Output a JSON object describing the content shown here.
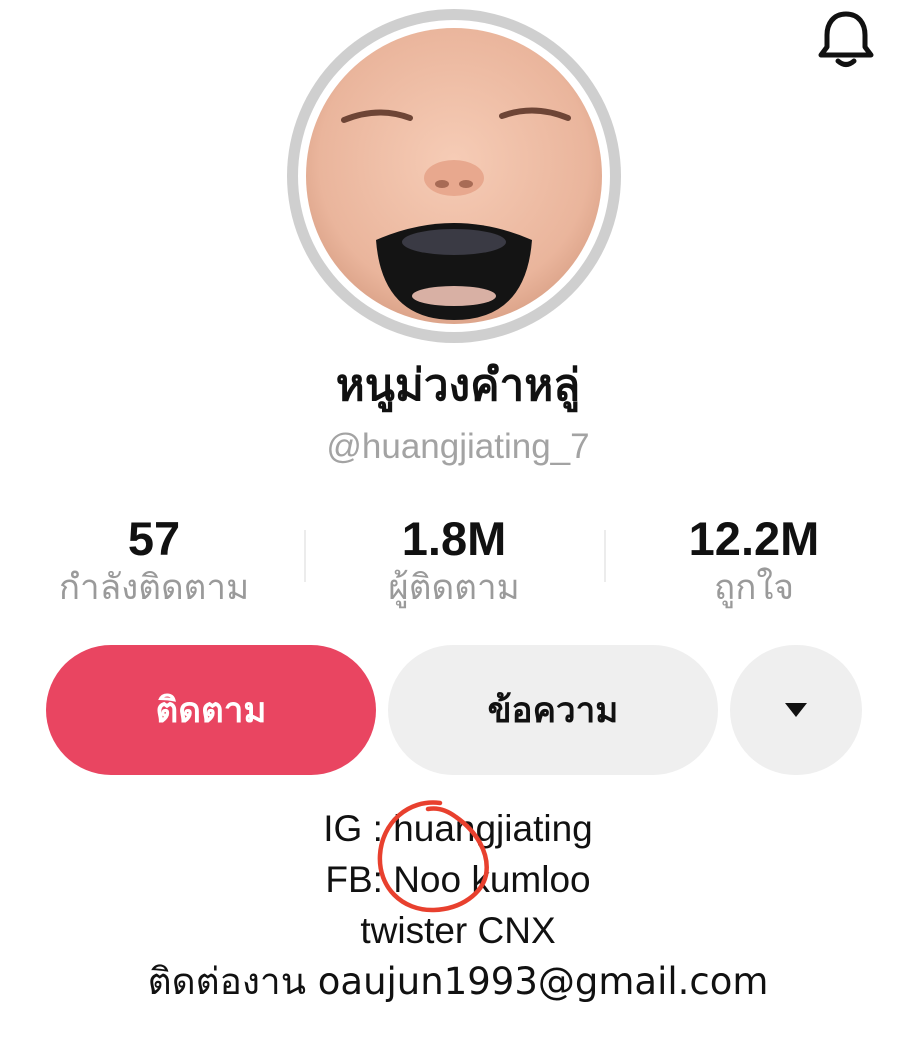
{
  "profile": {
    "display_name": "หนูม่วงคำหลู่",
    "username": "@huangjiating_7"
  },
  "stats": [
    {
      "value": "57",
      "label": "กำลังติดตาม"
    },
    {
      "value": "1.8M",
      "label": "ผู้ติดตาม"
    },
    {
      "value": "12.2M",
      "label": "ถูกใจ"
    }
  ],
  "actions": {
    "follow_label": "ติดตาม",
    "message_label": "ข้อความ",
    "more_icon": "caret-down-icon"
  },
  "bio": {
    "line1": "IG : huangjiating",
    "line2": "FB: Noo kumloo",
    "line3": "twister CNX",
    "line4": "ติดต่องาน oaujun1993@gmail.com"
  },
  "icons": {
    "notification": "bell-icon"
  },
  "colors": {
    "follow_button": "#e94561",
    "secondary_button": "#efefef",
    "muted_text": "#9a9a9a",
    "annotation": "#e8402e"
  }
}
